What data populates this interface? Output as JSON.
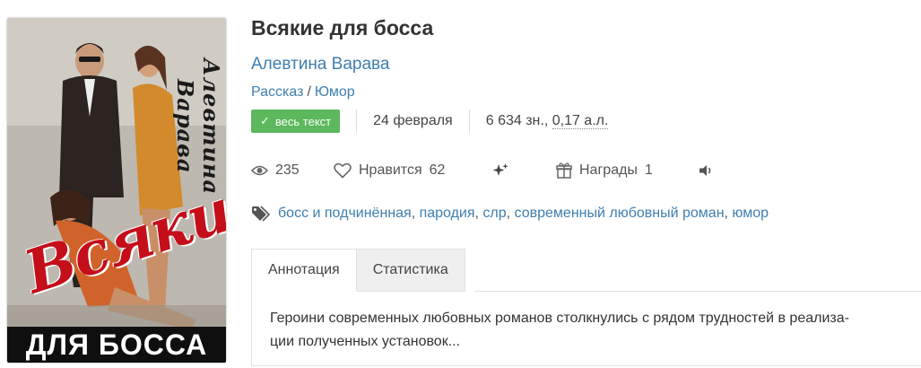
{
  "cover": {
    "author_text": "Алевтина Варава",
    "title_text": "Всякие",
    "subtitle_text": "ДЛЯ БОССА"
  },
  "book": {
    "title": "Всякие для босса",
    "author": "Алевтина Варава",
    "genres": [
      "Рассказ",
      "Юмор"
    ],
    "genre_separator": "/",
    "badge_label": "весь текст",
    "date": "24 февраля",
    "size_chars": "6 634 зн., ",
    "size_al": "0,17 а.л."
  },
  "stats": {
    "views": "235",
    "likes_label": "Нравится",
    "likes_count": "62",
    "awards_label": "Награды",
    "awards_count": "1"
  },
  "tags": [
    "босс и подчинённая",
    "пародия",
    "слр",
    "современный любовный роман",
    "юмор"
  ],
  "tabs": {
    "annotation": "Аннотация",
    "statistics": "Статистика"
  },
  "annotation_text_line1": "Героини современных любовных романов столкнулись с рядом трудностей в реализа-",
  "annotation_text_line2": "ции полученных установок...",
  "colors": {
    "link": "#3e7eae",
    "badge": "#5cb85c",
    "cover_title": "#c40e1a"
  }
}
